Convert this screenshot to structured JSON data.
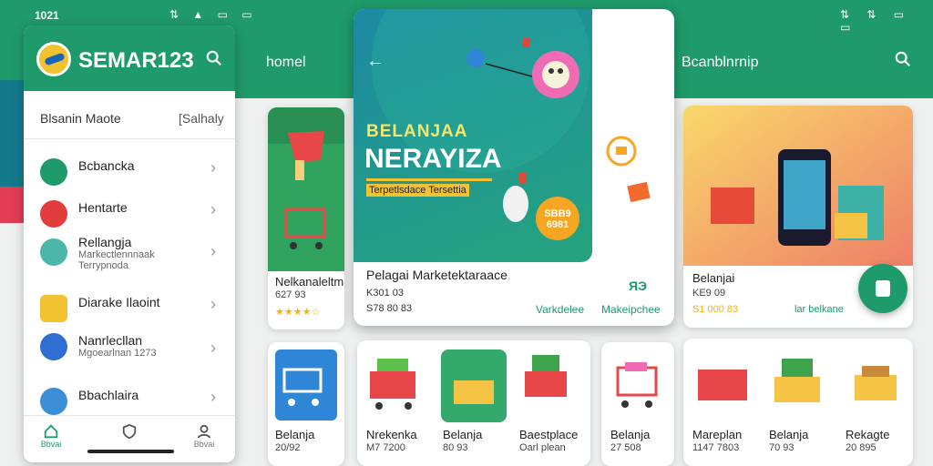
{
  "status": {
    "time": "1021",
    "left_icons": "⇅ ▲ ▭ ▭",
    "right_icons": "⇅ ⇅ ▭ ▭"
  },
  "header": {
    "tab_home": "homel",
    "right_title": "Bcanblnrnip",
    "more": "•••"
  },
  "drawer": {
    "brand": "SEMAR123",
    "sub_left": "Blsanin Maote",
    "sub_right": "[Salhaly",
    "items": [
      {
        "label": "Bcbancka",
        "sub": "",
        "icon_color": "#1f9a6a",
        "icon": "cart-icon"
      },
      {
        "label": "Hentarte",
        "sub": "",
        "icon_color": "#e23c3c",
        "icon": "store-icon"
      },
      {
        "label": "Rellangja",
        "sub": "Markectlennnaak Terrypnoda",
        "icon_color": "#4db6ac",
        "icon": "shop-icon"
      },
      {
        "label": "Diarake Ilaoint",
        "sub": "",
        "icon_color": "#f2c230",
        "icon": "basket-icon"
      },
      {
        "label": "Nanrlecllan",
        "sub": "Mgoearlnan 1273",
        "icon_color": "#2f6fd1",
        "icon": "bag-icon"
      },
      {
        "label": "Bbachlaira",
        "sub": "",
        "icon_color": "#3b8fd6",
        "icon": "box-icon"
      }
    ],
    "nav": [
      {
        "label": "Bbvai",
        "icon": "home-icon"
      },
      {
        "label": "",
        "icon": "shield-icon"
      },
      {
        "label": "Bbvai",
        "icon": "user-icon"
      }
    ]
  },
  "hero": {
    "title1": "BELANJAA",
    "title2": "NERAYIZA",
    "tag": "Terpetlsdace Tersettia",
    "badge": "SBB9 6981",
    "main_title": "Pelagai Marketektaraace",
    "code": "K301 03",
    "price": "S78 80 83",
    "link1": "Varkdelee",
    "link2": "Makeipchee",
    "mini_logo": "ЯЭ"
  },
  "cards_top": [
    {
      "title": "Nelkanaleltm",
      "code": "627 93",
      "stars": "★★★★☆"
    },
    {
      "title": "Belanjai",
      "code": "KE9 09",
      "price": "S1 000 83",
      "link": "lar belkane"
    }
  ],
  "cards_bottom": [
    {
      "title": "Belanja",
      "code": "20/92"
    },
    {
      "title": "Nrekenka",
      "code": "M7 7200"
    },
    {
      "title": "Belanja",
      "code": "80 93"
    },
    {
      "title": "Baestplace",
      "code": "Oarl plean"
    },
    {
      "title": "Belanja",
      "code": "27 508"
    },
    {
      "title": "Mareplan",
      "code": "1147 7803"
    },
    {
      "title": "Belanja",
      "code": "70 93"
    },
    {
      "title": "Rekagte",
      "code": "20 895"
    }
  ],
  "colors": {
    "primary": "#1f9a6a",
    "accent": "#f2c230",
    "red": "#e23c56",
    "teal": "#137a8c"
  }
}
